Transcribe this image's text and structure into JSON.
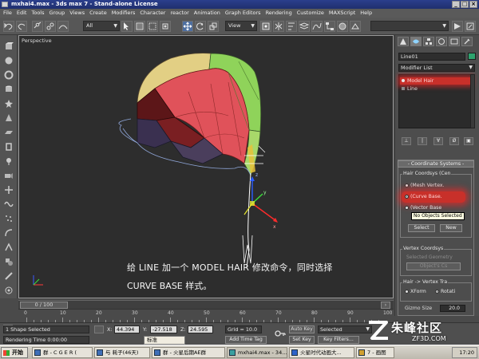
{
  "window": {
    "title": "mxhai4.max - 3ds max 7 - Stand-alone License",
    "controls": [
      "_",
      "□",
      "×"
    ]
  },
  "menu": [
    "File",
    "Edit",
    "Tools",
    "Group",
    "Views",
    "Create",
    "Modifiers",
    "Character",
    "reactor",
    "Animation",
    "Graph Editors",
    "Rendering",
    "Customize",
    "MAXScript",
    "Help"
  ],
  "toolbar": {
    "selection_filter": "All",
    "reference_coord": "View"
  },
  "viewport": {
    "label": "Perspective",
    "caption_line1": "给 LINE 加一个 MODEL HAIR 修改命令，同时选择",
    "caption_line2": "CURVE BASE 样式。"
  },
  "command_panel": {
    "object_name": "Line01",
    "object_color": "#2ea36e",
    "modifier_list_label": "Modifier List",
    "stack": [
      {
        "label": "Model Hair",
        "selected": true
      },
      {
        "label": "Line",
        "selected": false
      }
    ],
    "coord_rollout_title": "Coordinate Systems",
    "hair_coords_group": "Hair Coordsys (Cen",
    "options": [
      {
        "label": "(Mesh Vertex.",
        "on": false
      },
      {
        "label": "(Curve Base.",
        "on": true
      },
      {
        "label": "(Vector Base",
        "on": false
      }
    ],
    "tooltip": "No Objects Selected",
    "select_button": "Select",
    "new_button": "New",
    "vertex_coords_group": "Vertex Coordsys",
    "vertex_disabled_text": "Selected Geometry",
    "object_cs_button": "Object's Cs",
    "hair_vertex_group": "Hair -> Vertex Tra",
    "xform_label": "XForm",
    "rotate_label": "Rotati",
    "gizmo_size_label": "Gizmo Size",
    "gizmo_size_value": "20.0"
  },
  "time": {
    "slider_label": "0 / 100",
    "ticks": [
      "0",
      "10",
      "20",
      "30",
      "40",
      "50",
      "60",
      "70",
      "80",
      "90",
      "100"
    ]
  },
  "status": {
    "selection": "1 Shape Selected",
    "prompt": "Rendering Time  0:00:00",
    "x_label": "X:",
    "x": "44.394",
    "y_label": "Y:",
    "y": "-27.518",
    "z_label": "Z:",
    "z": "24.595",
    "grid": "Grid = 10.0",
    "add_time_tag": "Add Time Tag",
    "auto_key": "Auto Key",
    "key_mode": "Selected",
    "set_key": "Set Key",
    "key_filters": "Key Filters...",
    "ime_label": "标准"
  },
  "taskbar": {
    "start": "开始",
    "tasks": [
      "群 - C G E R (",
      "与 耗子(46天)",
      "群 - 火星后期AE群",
      "mxhai4.max - 34...",
      "火星时代动画大...",
      "7 - 画图"
    ],
    "clock": "17:20"
  },
  "watermark": {
    "main": "朱峰社区",
    "sub": "ZF3D.COM"
  },
  "colors": {
    "helmet_red": "#e0525a",
    "helmet_green": "#8fd35a",
    "helmet_yellow": "#e2cf84",
    "helmet_dark": "#5c1618",
    "highlight_red": "#c8302a"
  }
}
